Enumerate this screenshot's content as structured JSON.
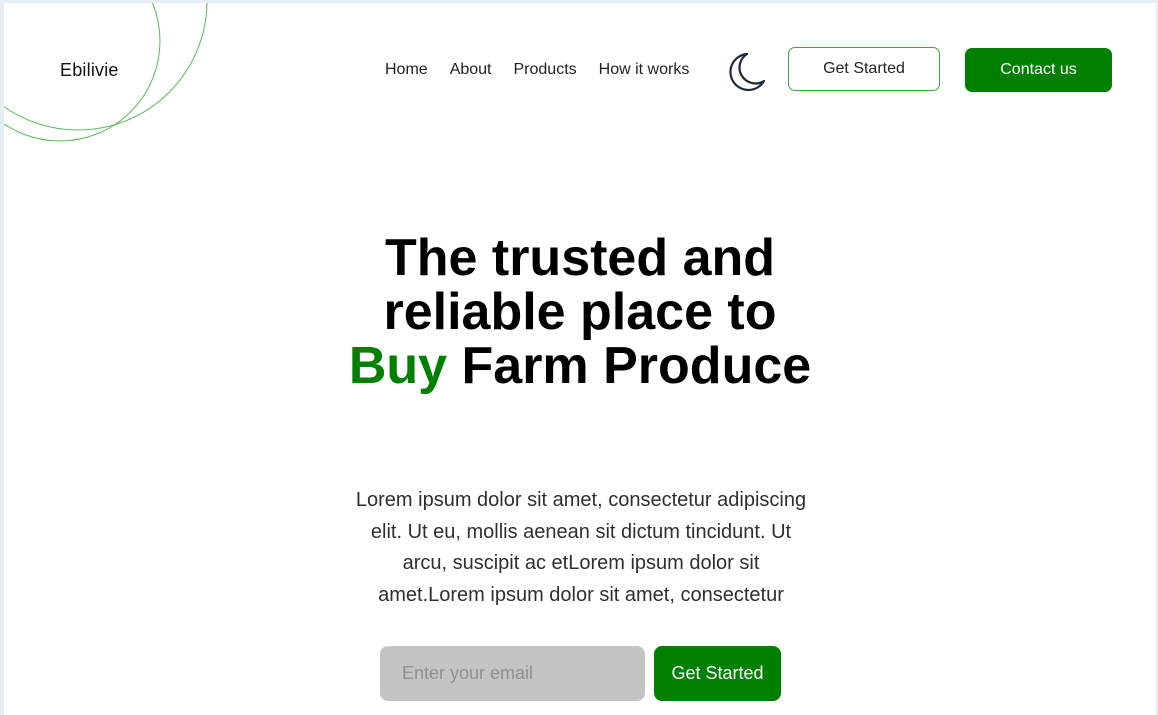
{
  "brand": {
    "logo_text": "Ebilivie",
    "accent_color": "#008000"
  },
  "nav": {
    "links": [
      {
        "label": "Home"
      },
      {
        "label": "About"
      },
      {
        "label": "Products"
      },
      {
        "label": "How it works"
      }
    ],
    "theme_toggle_icon": "moon-icon",
    "get_started_label": "Get Started",
    "contact_label": "Contact us"
  },
  "hero": {
    "title_part1": "The trusted and reliable place to",
    "title_accent": "Buy",
    "title_part2": "Farm Produce",
    "description": "Lorem ipsum dolor sit amet, consectetur adipiscing elit. Ut eu, mollis aenean sit dictum tincidunt. Ut arcu, suscipit ac etLorem ipsum dolor sit amet.Lorem ipsum dolor sit amet, consectetur",
    "email_placeholder": "Enter your email",
    "email_value": "",
    "cta_label": "Get Started"
  }
}
